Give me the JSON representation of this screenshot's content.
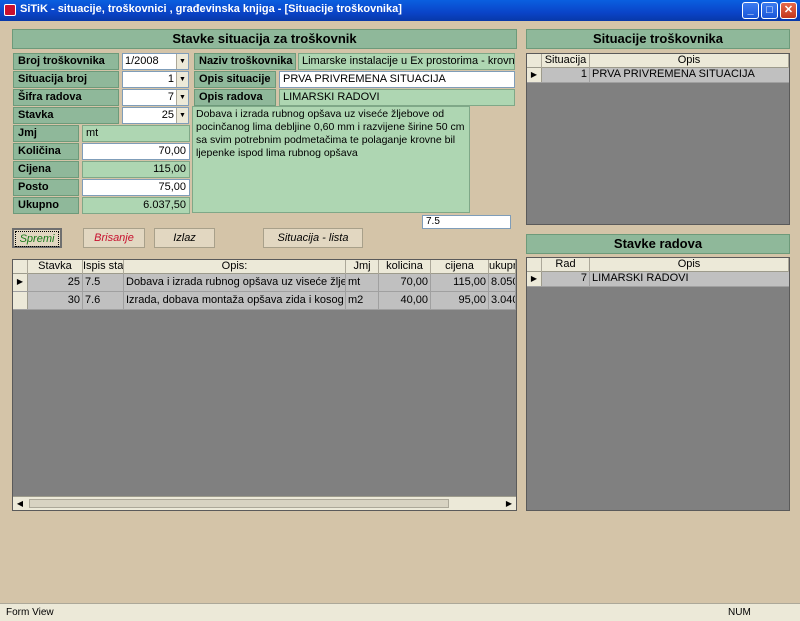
{
  "window": {
    "title": "SiTiK - situacije, troškovnici , građevinska knjiga - [Situacije troškovnika]"
  },
  "form": {
    "header": "Stavke situacija za troškovnik",
    "labels": {
      "broj": "Broj troškovnika",
      "situacija_broj": "Situacija broj",
      "sifra_radova": "Šifra radova",
      "stavka": "Stavka",
      "jmj": "Jmj",
      "kolicina": "Količina",
      "cijena": "Cijena",
      "posto": "Posto",
      "ukupno": "Ukupno",
      "naziv": "Naziv troškovnika",
      "opis_situacije": "Opis situacije",
      "opis_radova": "Opis radova"
    },
    "values": {
      "broj": "1/2008",
      "situacija_broj": "1",
      "sifra_radova": "7",
      "stavka": "25",
      "jmj": "mt",
      "kolicina": "70,00",
      "cijena": "115,00",
      "posto": "75,00",
      "ukupno": "6.037,50",
      "naziv": "Limarske instalacije u Ex prostorima - krovne kon",
      "opis_situacije": "PRVA PRIVREMENA SITUACIJA",
      "opis_radova": "LIMARSKI RADOVI",
      "stavka_opis": "Dobava i izrada rubnog opšava uz viseće žljebove od pocinčanog lima debljine 0,60 mm i razvijene širine 50 cm sa svim potrebnim podmetačima te polaganje krovne bil ljepenke ispod lima rubnog opšava",
      "ispis": "7.5"
    }
  },
  "buttons": {
    "spremi": "Spremi",
    "brisanje": "Brisanje",
    "izlaz": "Izlaz",
    "lista": "Situacija - lista"
  },
  "stavke_grid": {
    "headers": [
      "Stavka",
      "Ispis sta",
      "Opis:",
      "Jmj",
      "kolicina",
      "cijena",
      "ukupno"
    ],
    "rows": [
      {
        "stavka": "25",
        "ispis": "7.5",
        "opis": "Dobava i izrada rubnog opšava uz viseće žlje",
        "jmj": "mt",
        "kolicina": "70,00",
        "cijena": "115,00",
        "ukupno": "8.050"
      },
      {
        "stavka": "30",
        "ispis": "7.6",
        "opis": "Izrada, dobava montaža opšava zida i kosog kro",
        "jmj": "m2",
        "kolicina": "40,00",
        "cijena": "95,00",
        "ukupno": "3.040"
      }
    ]
  },
  "situacije": {
    "header": "Situacije troškovnika",
    "headers": [
      "Situacija",
      "Opis"
    ],
    "rows": [
      {
        "situacija": "1",
        "opis": "PRVA PRIVREMENA SITUACIJA"
      }
    ]
  },
  "stavke_radova": {
    "header": "Stavke radova",
    "headers": [
      "Rad",
      "Opis"
    ],
    "rows": [
      {
        "rad": "7",
        "opis": "LIMARSKI RADOVI"
      }
    ]
  },
  "statusbar": {
    "left": "Form View",
    "right": "NUM"
  }
}
